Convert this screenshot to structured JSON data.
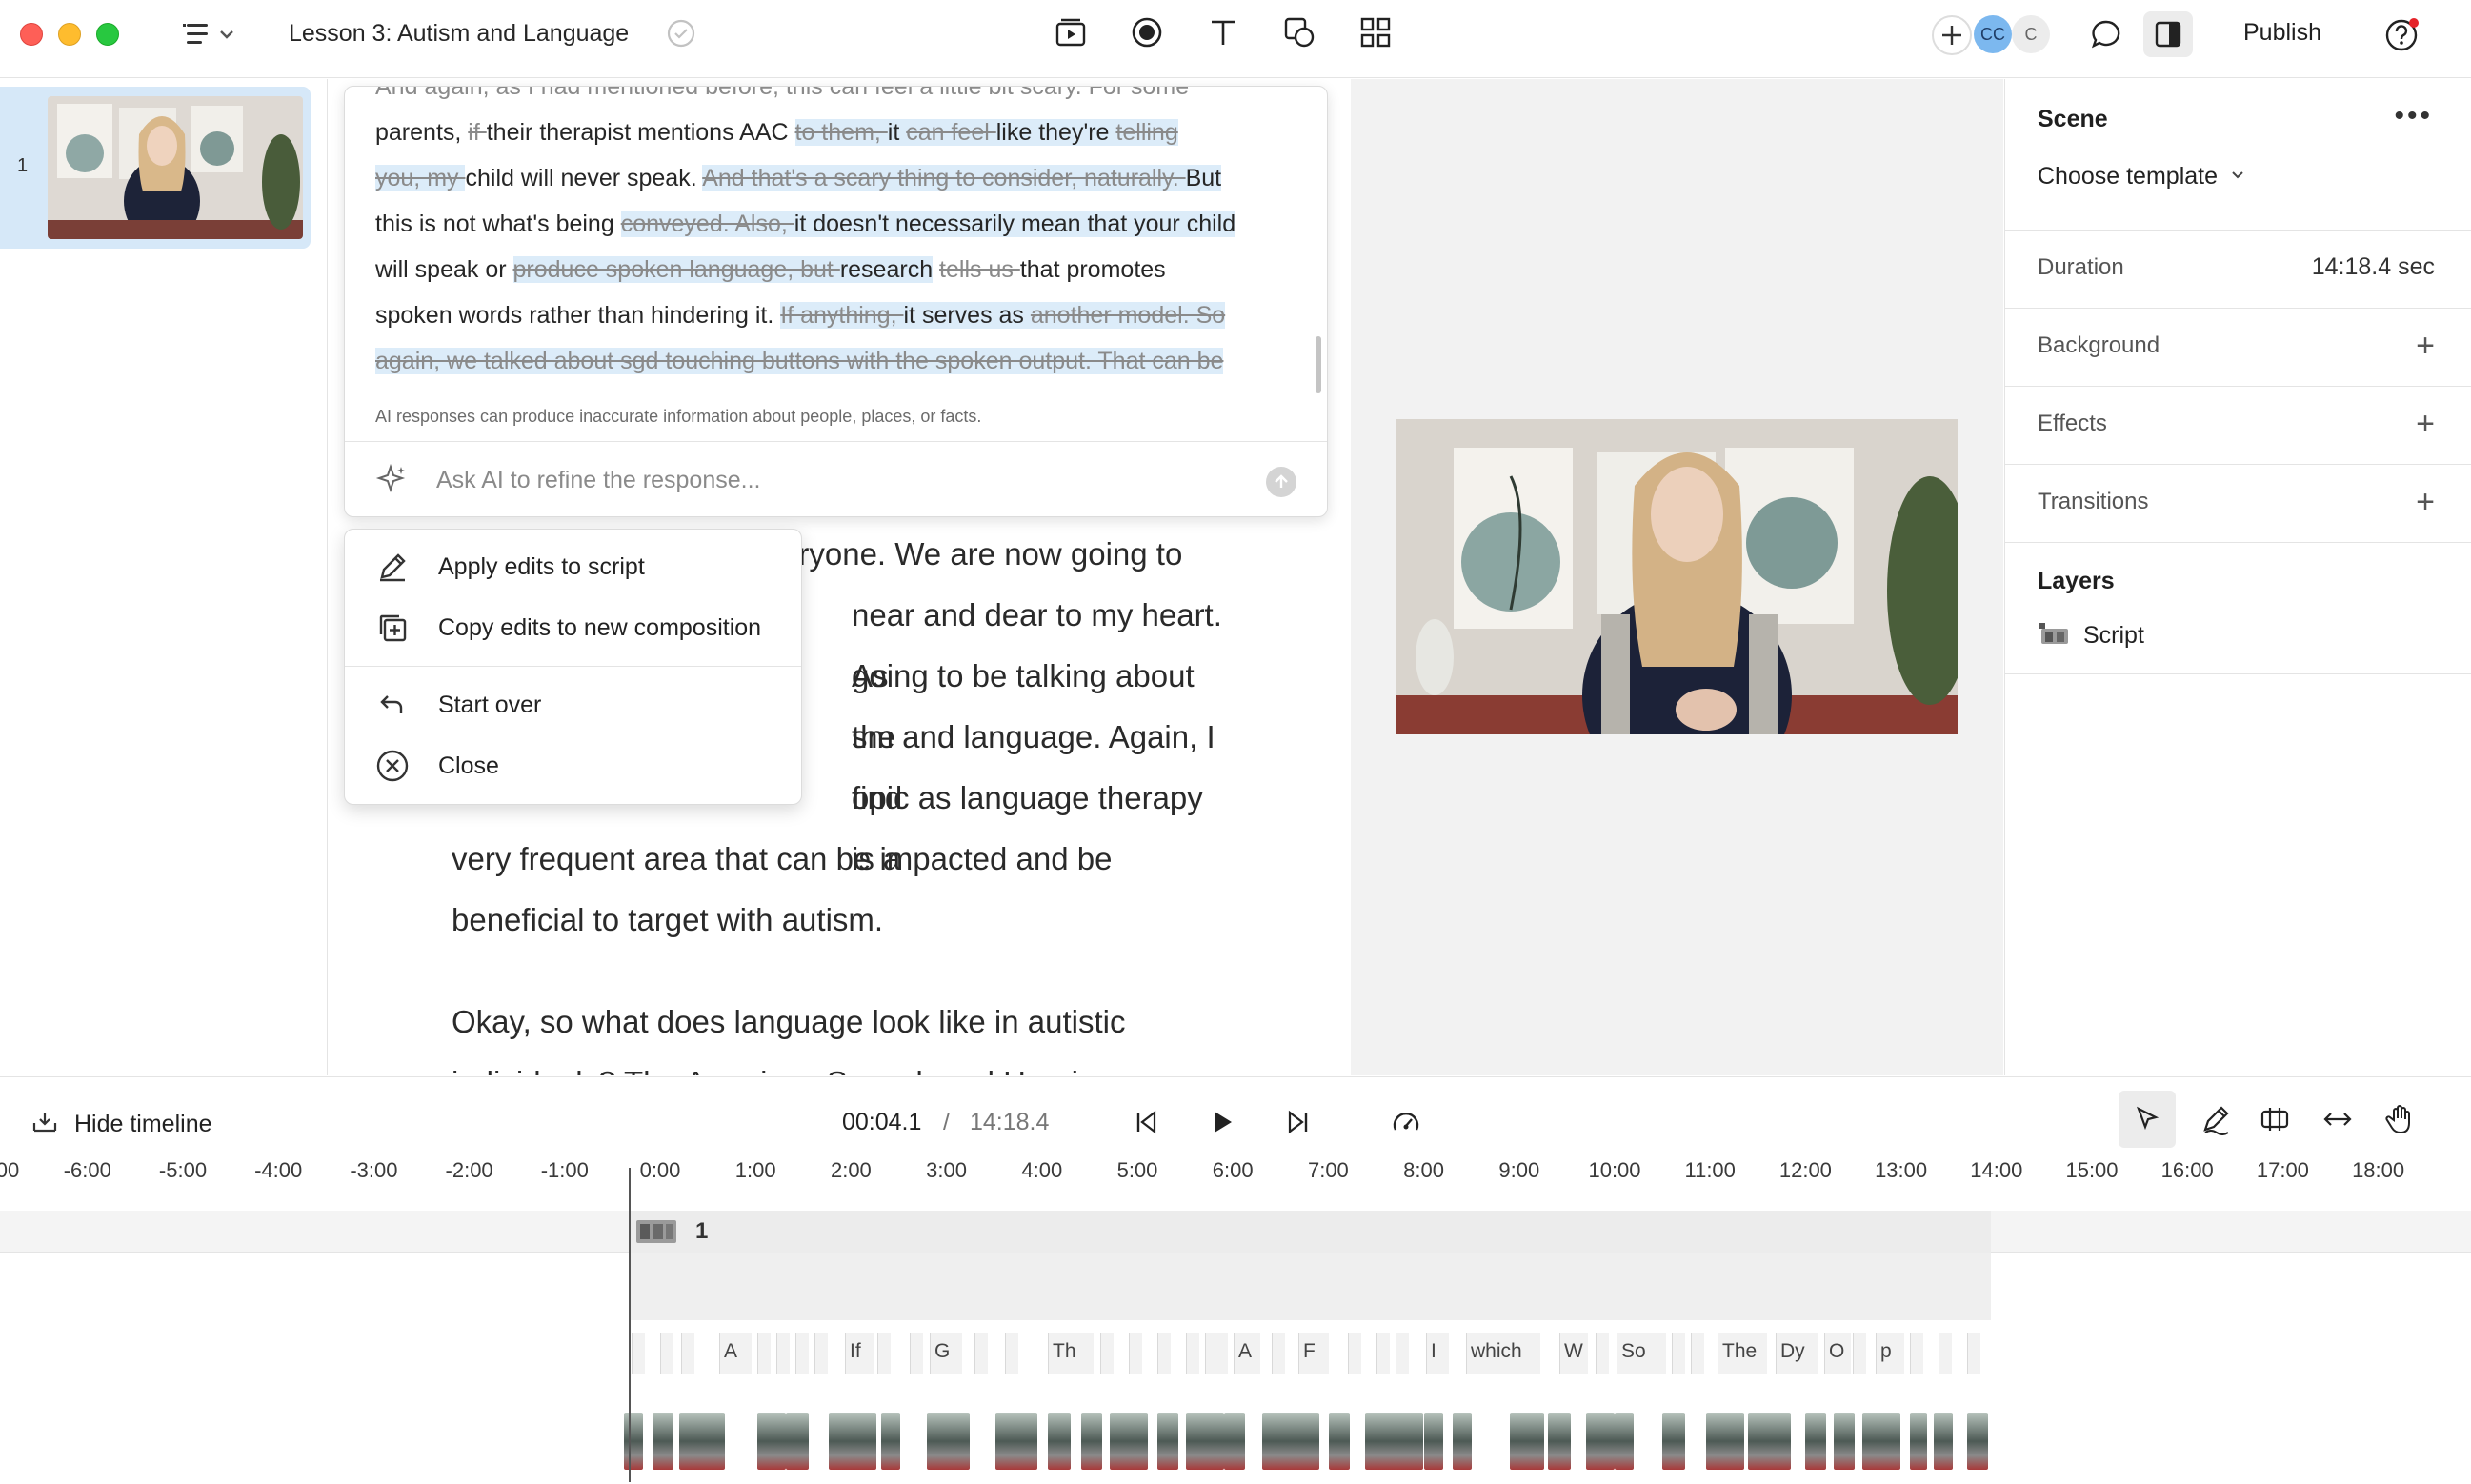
{
  "app": {
    "doc_title": "Lesson 3: Autism and Language",
    "publish_label": "Publish",
    "avatar_initials_1": "CC",
    "avatar_initials_2": "C"
  },
  "sidebar": {
    "scene_number": "1"
  },
  "ai_card": {
    "fragment_top": "And again, as I had mentioned before, this can feel a little bit scary. For some",
    "disclaimer": "AI responses can produce inaccurate information about people, places, or facts.",
    "input_placeholder": "Ask AI to refine the response..."
  },
  "menu": {
    "apply": "Apply edits to script",
    "copy": "Copy edits to new composition",
    "start_over": "Start over",
    "close": "Close"
  },
  "script": {
    "p1_line0": "Okay, welcome back everyone. We are now going to",
    "p1_line1": "near and dear to my heart. As",
    "p1_line2": "going to be talking about the",
    "p1_line3": "sm and language. Again, I find",
    "p1_line4": "opic as language therapy is a",
    "p1_line5": "very frequent area that can be impacted and be",
    "p1_line6": "beneficial to target with autism.",
    "p2_line0": "Okay, so what does language look like in autistic",
    "p2_line1": "individuals? The American Speech and Hearing"
  },
  "properties": {
    "title": "Scene",
    "template_label": "Choose template",
    "duration_label": "Duration",
    "duration_value": "14:18.4 sec",
    "background_label": "Background",
    "effects_label": "Effects",
    "transitions_label": "Transitions",
    "layers_title": "Layers",
    "layer_script": "Script"
  },
  "timeline": {
    "hide_label": "Hide timeline",
    "current_time": "00:04.1",
    "separator": "/",
    "total_time": "14:18.4",
    "scene_clip_label": "1",
    "ruler_ticks": [
      "00",
      "-6:00",
      "-5:00",
      "-4:00",
      "-3:00",
      "-2:00",
      "-1:00",
      "0:00",
      "1:00",
      "2:00",
      "3:00",
      "4:00",
      "5:00",
      "6:00",
      "7:00",
      "8:00",
      "9:00",
      "10:00",
      "11:00",
      "12:00",
      "13:00",
      "14:00",
      "15:00",
      "16:00",
      "17:00",
      "18:00"
    ],
    "words": [
      "A",
      "If",
      "G",
      "Th",
      "A",
      "F",
      "I",
      "which",
      "W",
      "So",
      "The",
      "Dy",
      "O",
      "p"
    ]
  },
  "colors": {
    "highlight": "#dcecf9",
    "selected_scene": "#d6e8f8",
    "avatar_blue": "#7cb8ef"
  }
}
